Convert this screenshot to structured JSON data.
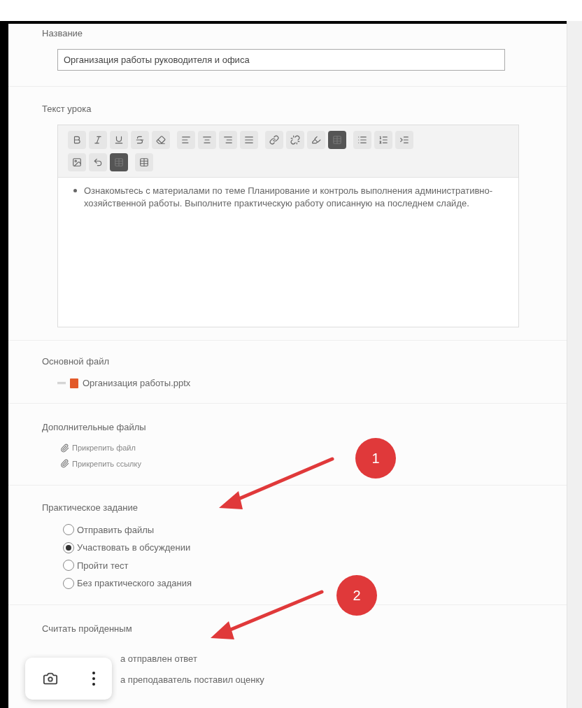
{
  "title_section": {
    "label": "Название",
    "value": "Организация работы руководителя и офиса"
  },
  "lesson_text": {
    "label": "Текст урока",
    "content": "Ознакомьтесь с материалами по теме Планирование и контроль выполнения административно-хозяйственной работы. Выполните практическую работу описанную на последнем слайде."
  },
  "main_file": {
    "label": "Основной файл",
    "file_name": "Организация работы.pptx"
  },
  "extra_files": {
    "label": "Дополнительные файлы",
    "links": [
      "Прикрепить файл",
      "Прикрепить ссылку"
    ]
  },
  "practical_task": {
    "label": "Практическое задание",
    "options": [
      {
        "label": "Отправить файлы",
        "selected": false
      },
      {
        "label": "Участвовать в обсуждении",
        "selected": true
      },
      {
        "label": "Пройти тест",
        "selected": false
      },
      {
        "label": "Без практического задания",
        "selected": false
      }
    ]
  },
  "completion": {
    "label": "Считать пройденным",
    "options": [
      "а отправлен ответ",
      "а преподаватель поставил оценку"
    ]
  },
  "annotations": [
    "1",
    "2"
  ]
}
